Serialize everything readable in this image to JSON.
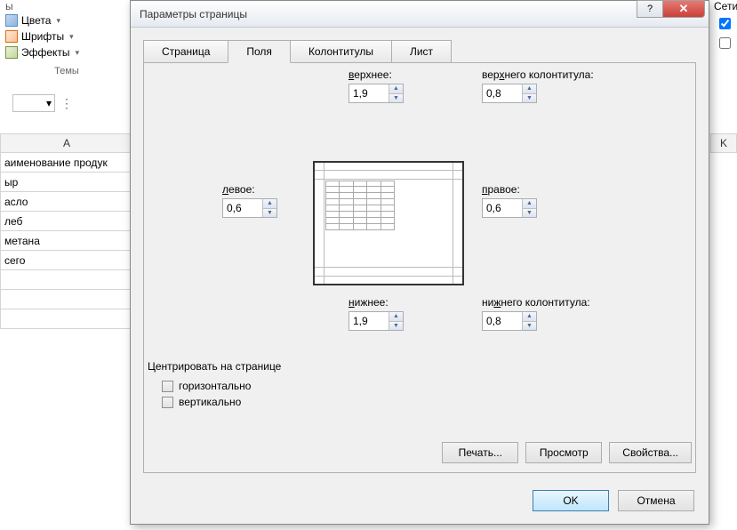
{
  "ribbon": {
    "colors": "Цвета",
    "fonts": "Шрифты",
    "effects": "Эффекты",
    "themes_label": "Темы",
    "right_label": "Сети",
    "right_check1": true,
    "right_check2": false
  },
  "sheet": {
    "col_left": "A",
    "col_right": "K",
    "rows": [
      "аименование продук",
      "ыр",
      "асло",
      "леб",
      "метана",
      "сего",
      "",
      "",
      ""
    ]
  },
  "dialog": {
    "title": "Параметры страницы",
    "tabs": [
      "Страница",
      "Поля",
      "Колонтитулы",
      "Лист"
    ],
    "active_tab": 1,
    "fields": {
      "top_label": "верхнее:",
      "top_value": "1,9",
      "header_label": "верхнего колонтитула:",
      "header_value": "0,8",
      "left_label": "левое:",
      "left_value": "0,6",
      "right_label": "правое:",
      "right_value": "0,6",
      "bottom_label": "нижнее:",
      "bottom_value": "1,9",
      "footer_label": "нижнего колонтитула:",
      "footer_value": "0,8"
    },
    "center": {
      "title": "Центрировать на странице",
      "horizontal": "горизонтально",
      "vertical": "вертикально"
    },
    "buttons": {
      "print": "Печать...",
      "preview": "Просмотр",
      "options": "Свойства...",
      "ok": "OK",
      "cancel": "Отмена"
    }
  }
}
